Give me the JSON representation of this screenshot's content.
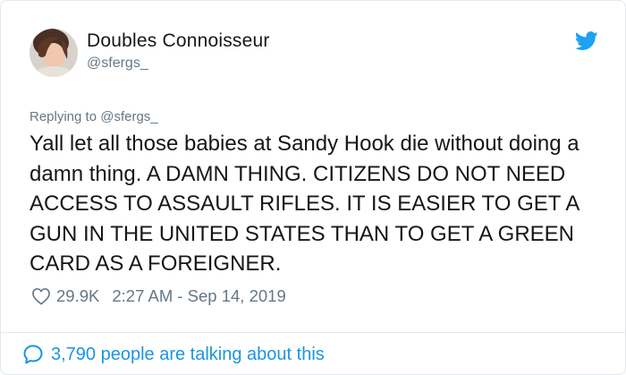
{
  "author": {
    "name": "Doubles Connoisseur",
    "handle": "@sfergs_"
  },
  "reply_context": "Replying to @sfergs_",
  "tweet": {
    "text": "Yall let all those babies at Sandy Hook die without doing a damn thing. A DAMN THING. CITIZENS DO NOT NEED ACCESS TO ASSAULT RIFLES. IT IS EASIER TO GET A GUN IN THE UNITED STATES THAN TO GET A GREEN CARD AS A FOREIGNER."
  },
  "meta": {
    "likes": "29.9K",
    "timestamp": "2:27 AM - Sep 14, 2019"
  },
  "footer": {
    "talking": "3,790 people are talking about this"
  },
  "icons": {
    "brand": "twitter-bird-icon",
    "like": "heart-icon",
    "conversation": "speech-bubble-icon"
  },
  "colors": {
    "twitter_blue": "#1da1f2",
    "link_blue": "#1b95e0",
    "secondary_text": "#657786",
    "border": "#e1e8ed"
  }
}
